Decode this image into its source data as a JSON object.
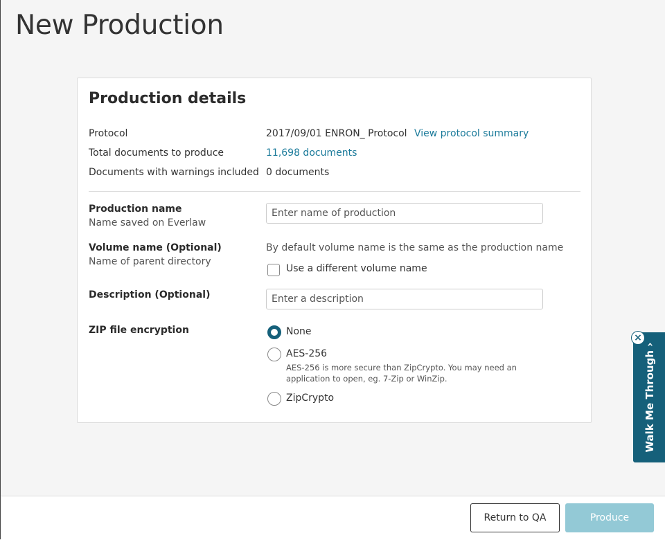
{
  "page": {
    "title": "New Production"
  },
  "card": {
    "title": "Production details",
    "protocol": {
      "label": "Protocol",
      "value": "2017/09/01 ENRON_ Protocol",
      "link": "View protocol summary"
    },
    "total_docs": {
      "label": "Total documents to produce",
      "value": "11,698 documents"
    },
    "warnings": {
      "label": "Documents with warnings included",
      "value": "0 documents"
    },
    "production_name": {
      "label": "Production name",
      "sub": "Name saved on Everlaw",
      "placeholder": "Enter name of production",
      "value": ""
    },
    "volume_name": {
      "label": "Volume name (Optional)",
      "sub": "Name of parent directory",
      "hint": "By default volume name is the same as the production name",
      "checkbox_label": "Use a different volume name",
      "checked": false
    },
    "description": {
      "label": "Description (Optional)",
      "placeholder": "Enter a description",
      "value": ""
    },
    "zip": {
      "label": "ZIP file encryption",
      "selected": "None",
      "options": [
        {
          "label": "None"
        },
        {
          "label": "AES-256",
          "description": "AES-256 is more secure than ZipCrypto. You may need an application to open, eg. 7-Zip or WinZip."
        },
        {
          "label": "ZipCrypto"
        }
      ]
    }
  },
  "footer": {
    "return_label": "Return to QA",
    "produce_label": "Produce"
  },
  "walkme": {
    "label": "Walk Me Through ›",
    "close": "×"
  },
  "colors": {
    "accent": "#15607a",
    "link": "#1a7a9a",
    "primary_disabled": "#93c9d6"
  }
}
